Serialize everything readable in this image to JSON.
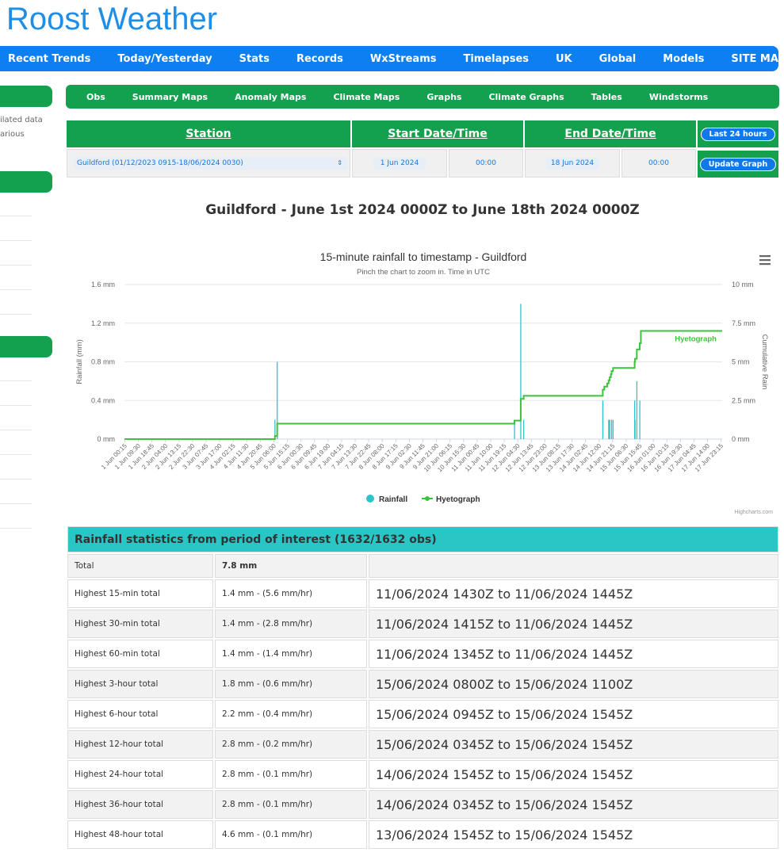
{
  "site": {
    "title": "Roost Weather"
  },
  "mainnav": [
    "Recent Trends",
    "Today/Yesterday",
    "Stats",
    "Records",
    "WxStreams",
    "Timelapses",
    "UK",
    "Global",
    "Models",
    "SITE MAP"
  ],
  "sidebar": {
    "text1": "ilated data",
    "text2": "arious"
  },
  "subnav": [
    "Obs",
    "Summary Maps",
    "Anomaly Maps",
    "Climate Maps",
    "Graphs",
    "Climate Graphs",
    "Tables",
    "Windstorms"
  ],
  "controls": {
    "station_header": "Station",
    "start_header": "Start Date/Time",
    "end_header": "End Date/Time",
    "last24_label": "Last 24 hours",
    "update_label": "Update Graph",
    "station_value": "Guildford (01/12/2023 0915-18/06/2024 0030)",
    "start_date": "1 Jun 2024",
    "start_time": "00:00",
    "end_date": "18 Jun 2024",
    "end_time": "00:00"
  },
  "page_heading": "Guildford - June 1st 2024 0000Z to June 18th 2024 0000Z",
  "chart_data": {
    "type": "bar+line",
    "title": "15-minute rainfall to timestamp - Guildford",
    "subtitle": "Pinch the chart to zoom in. Time in UTC",
    "ylabel_left": "Rainfall (mm)",
    "ylabel_right": "Cumulative Rain",
    "left_ticks": [
      "0 mm",
      "0.4 mm",
      "0.8 mm",
      "1.2 mm",
      "1.6 mm"
    ],
    "right_ticks": [
      "0 mm",
      "2.5 mm",
      "5 mm",
      "7.5 mm",
      "10 mm"
    ],
    "ylim_left": [
      0,
      1.6
    ],
    "ylim_right": [
      0,
      10
    ],
    "x_range_hours": [
      0,
      408
    ],
    "x_ticks": [
      "1 Jun 00:15",
      "1 Jun 09:30",
      "1 Jun 18:45",
      "2 Jun 04:00",
      "2 Jun 13:15",
      "2 Jun 22:30",
      "3 Jun 07:45",
      "3 Jun 17:00",
      "4 Jun 02:15",
      "4 Jun 11:30",
      "4 Jun 20:45",
      "5 Jun 06:00",
      "5 Jun 15:15",
      "6 Jun 00:30",
      "6 Jun 09:45",
      "6 Jun 19:00",
      "7 Jun 04:15",
      "7 Jun 13:30",
      "7 Jun 22:45",
      "8 Jun 08:00",
      "8 Jun 17:15",
      "9 Jun 02:30",
      "9 Jun 11:45",
      "9 Jun 21:00",
      "10 Jun 06:15",
      "10 Jun 15:30",
      "11 Jun 00:45",
      "11 Jun 10:00",
      "11 Jun 19:15",
      "12 Jun 04:30",
      "12 Jun 13:45",
      "12 Jun 23:00",
      "13 Jun 08:15",
      "13 Jun 17:30",
      "14 Jun 02:45",
      "14 Jun 12:00",
      "14 Jun 21:15",
      "15 Jun 06:30",
      "15 Jun 15:45",
      "16 Jun 01:00",
      "16 Jun 10:15",
      "16 Jun 19:30",
      "17 Jun 04:45",
      "17 Jun 14:00",
      "17 Jun 23:15"
    ],
    "legend": [
      "Rainfall",
      "Hyetograph"
    ],
    "legend_position": "bottom-center",
    "series_label": "Hyetograph",
    "credit": "Highcharts.com",
    "colors": {
      "rainfall": "#2ec4c9",
      "hyetograph": "#3cc23c",
      "grid": "#e6e6e6"
    },
    "rainfall_hours": [
      102.7,
      104.25,
      266.25,
      270.5,
      272.5,
      326.5,
      330.5,
      331.25,
      332.5,
      333.5,
      348.25,
      348.5,
      349.75,
      351.75
    ],
    "rainfall_values": [
      0.2,
      0.8,
      0.2,
      1.4,
      0.2,
      0.4,
      0.2,
      0.2,
      0.2,
      0.2,
      0.4,
      0.2,
      0.6,
      0.4
    ],
    "hyetograph_hours": [
      0,
      102.5,
      102.7,
      104.25,
      266.0,
      266.25,
      270.25,
      270.5,
      272.25,
      272.5,
      322.0,
      326.5,
      327.5,
      329.5,
      330.5,
      331.25,
      332.0,
      332.5,
      333.5,
      347.5,
      348.25,
      348.5,
      349.75,
      351.75,
      352.5,
      408
    ],
    "hyetograph_values": [
      0,
      0,
      0.2,
      1.0,
      1.0,
      1.2,
      1.2,
      2.6,
      2.6,
      2.8,
      2.8,
      3.2,
      3.4,
      3.6,
      3.8,
      4.0,
      4.2,
      4.4,
      4.6,
      4.6,
      5.0,
      5.2,
      5.8,
      6.2,
      7.0,
      7.0
    ]
  },
  "stats": {
    "header": "Rainfall statistics from period of interest (1632/1632 obs)",
    "total_label": "Total",
    "total_value": "7.8 mm",
    "rows": [
      {
        "label": "Highest 15-min total",
        "value": "1.4 mm - (5.6 mm/hr)",
        "period": "11/06/2024 1430Z to 11/06/2024 1445Z"
      },
      {
        "label": "Highest 30-min total",
        "value": "1.4 mm - (2.8 mm/hr)",
        "period": "11/06/2024 1415Z to 11/06/2024 1445Z"
      },
      {
        "label": "Highest 60-min total",
        "value": "1.4 mm - (1.4 mm/hr)",
        "period": "11/06/2024 1345Z to 11/06/2024 1445Z"
      },
      {
        "label": "Highest 3-hour total",
        "value": "1.8 mm - (0.6 mm/hr)",
        "period": "15/06/2024 0800Z to 15/06/2024 1100Z"
      },
      {
        "label": "Highest 6-hour total",
        "value": "2.2 mm - (0.4 mm/hr)",
        "period": "15/06/2024 0945Z to 15/06/2024 1545Z"
      },
      {
        "label": "Highest 12-hour total",
        "value": "2.8 mm - (0.2 mm/hr)",
        "period": "15/06/2024 0345Z to 15/06/2024 1545Z"
      },
      {
        "label": "Highest 24-hour total",
        "value": "2.8 mm - (0.1 mm/hr)",
        "period": "14/06/2024 1545Z to 15/06/2024 1545Z"
      },
      {
        "label": "Highest 36-hour total",
        "value": "2.8 mm - (0.1 mm/hr)",
        "period": "14/06/2024 0345Z to 15/06/2024 1545Z"
      },
      {
        "label": "Highest 48-hour total",
        "value": "4.6 mm - (0.1 mm/hr)",
        "period": "13/06/2024 1545Z to 15/06/2024 1545Z"
      }
    ]
  }
}
